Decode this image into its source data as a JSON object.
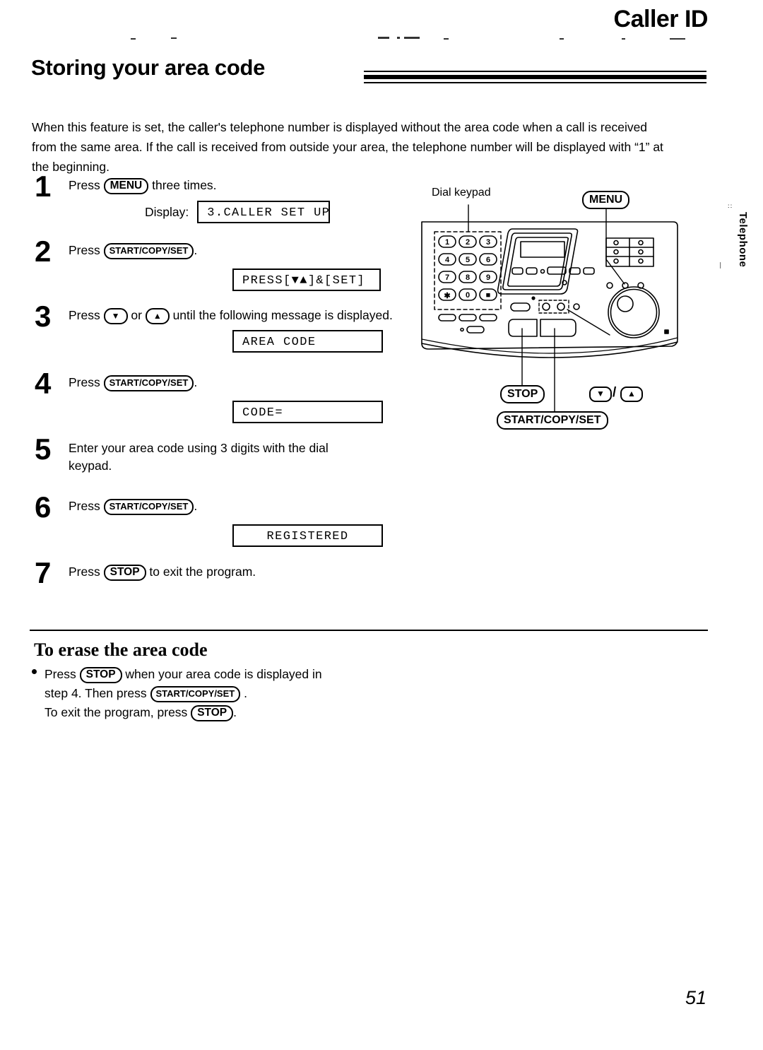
{
  "header": {
    "chapter_title": "Caller ID"
  },
  "section": {
    "heading": "Storing your area code",
    "intro": "When this feature is set, the caller's telephone number is displayed without the area code when a call is received from the same area. If the call is received from outside your area, the telephone number will be displayed with “1” at the beginning."
  },
  "steps": [
    {
      "number": "1",
      "text_before": "Press",
      "key": "MENU",
      "text_after": "three times.",
      "display_label": "Display:",
      "display_value": "3.CALLER SET UP"
    },
    {
      "number": "2",
      "text_before": "Press",
      "key": "START/COPY/SET",
      "text_after": ".",
      "display_value": "PRESS[▼▲]&[SET]"
    },
    {
      "number": "3",
      "text_before": "Press",
      "key_down": "▼",
      "text_mid": "or",
      "key_up": "▲",
      "text_after": "until the following message is displayed.",
      "display_value": "AREA CODE"
    },
    {
      "number": "4",
      "text_before": "Press",
      "key": "START/COPY/SET",
      "text_after": ".",
      "display_value": "CODE="
    },
    {
      "number": "5",
      "text_before": "Enter your area code using 3 digits with the dial keypad."
    },
    {
      "number": "6",
      "text_before": "Press",
      "key": "START/COPY/SET",
      "text_after": ".",
      "display_value": "REGISTERED"
    },
    {
      "number": "7",
      "text_before": "Press",
      "key": "STOP",
      "text_after": "to exit the program."
    }
  ],
  "erase_section": {
    "heading": "To erase the area code",
    "line1_before": "Press",
    "line1_key": "STOP",
    "line1_after": "when your area code is displayed in",
    "line2_before": "step 4. Then press",
    "line2_key": "START/COPY/SET",
    "line2_after": ".",
    "line3_before": "To exit the program, press",
    "line3_key": "STOP",
    "line3_after": "."
  },
  "diagram": {
    "dial_keypad_label": "Dial keypad",
    "menu_label": "MENU",
    "stop_label": "STOP",
    "start_label": "START/COPY/SET",
    "down_key": "▼",
    "slash": "/",
    "up_key": "▲",
    "keypad_keys": [
      "1",
      "2",
      "3",
      "4",
      "5",
      "6",
      "7",
      "8",
      "9",
      "✳",
      "0",
      "■"
    ]
  },
  "side_tab": {
    "label": "Telephone"
  },
  "footer": {
    "page_number": "51"
  },
  "colors": {
    "ink": "#000000",
    "paper": "#ffffff"
  }
}
